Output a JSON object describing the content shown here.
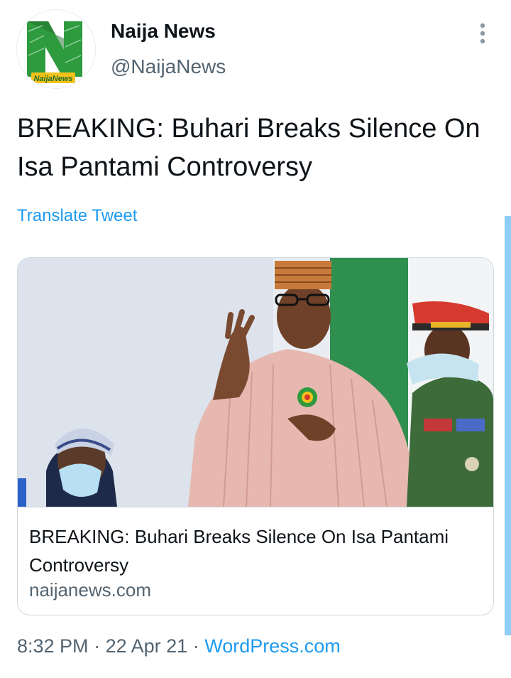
{
  "author": {
    "display_name": "Naija News",
    "handle": "@NaijaNews",
    "avatar_logo_text": "NaijaNews"
  },
  "tweet": {
    "text": "BREAKING: Buhari Breaks Silence On Isa Pantami Controversy",
    "translate_label": "Translate Tweet"
  },
  "card": {
    "title": "BREAKING: Buhari Breaks Silence On Isa Pantami Controversy",
    "domain": "naijanews.com"
  },
  "meta": {
    "time": "8:32 PM",
    "separator": "·",
    "date": "22 Apr 21",
    "source": "WordPress.com"
  },
  "icons": {
    "more": "more-vertical-icon"
  },
  "colors": {
    "link": "#1d9bf0",
    "secondary_text": "#536471",
    "logo_green": "#2e9b3f",
    "logo_dark_green": "#1f6e2c"
  }
}
